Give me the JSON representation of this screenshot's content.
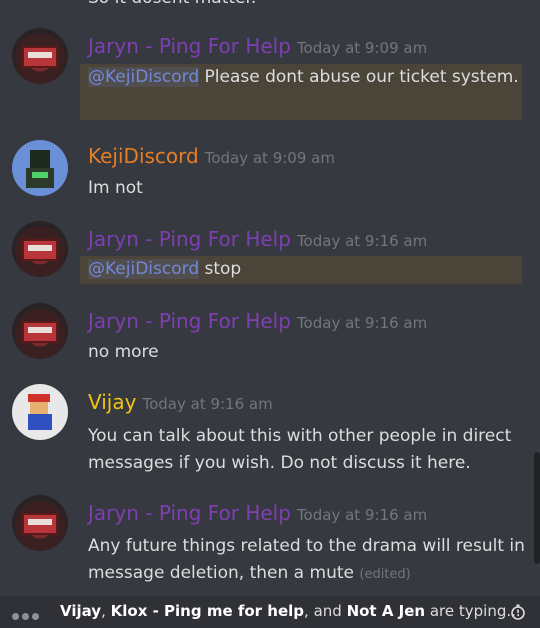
{
  "cutoff_text": "So it dosent matter.",
  "colors": {
    "mention_highlight": "#4a4538",
    "mention_text": "#7289da",
    "jaryn": "#7e3fb3",
    "keji": "#e67e22",
    "vijay": "#f1c40f"
  },
  "messages": [
    {
      "author": "Jaryn - Ping For Help",
      "time": "Today at 9:09 am",
      "mention": "@KejiDiscord",
      "text": " Please dont abuse our ticket system."
    },
    {
      "author": "KejiDiscord",
      "time": "Today at 9:09 am",
      "text": "Im not"
    },
    {
      "author": "Jaryn - Ping For Help",
      "time": "Today at 9:16 am",
      "mention": "@KejiDiscord",
      "text": " stop"
    },
    {
      "author": "Jaryn - Ping For Help",
      "time": "Today at 9:16 am",
      "text": "no more"
    },
    {
      "author": "Vijay",
      "time": "Today at 9:16 am",
      "text": "You can talk about this with other people in direct messages if you wish. Do not discuss it here."
    },
    {
      "author": "Jaryn - Ping For Help",
      "time": "Today at 9:16 am",
      "text": "Any future things related to the drama will result in message deletion, then a mute",
      "edited": "(edited)"
    }
  ],
  "typing": {
    "user1": "Vijay",
    "sep1": ", ",
    "user2": "Klox - Ping me for help",
    "sep2": ", and ",
    "user3": "Not A Jen",
    "suffix": " are typing..."
  },
  "icons": {
    "typing": "typing-dots-icon",
    "timer": "stopwatch-icon"
  }
}
